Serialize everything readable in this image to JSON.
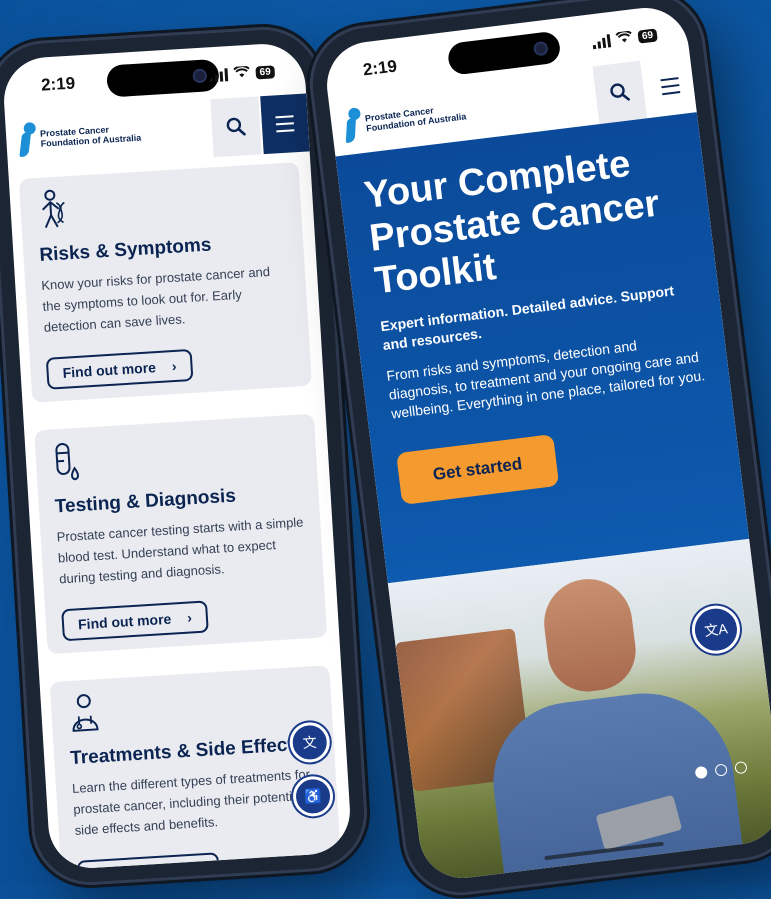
{
  "status": {
    "time": "2:19",
    "battery": "69"
  },
  "brand": {
    "name_line1": "Prostate Cancer",
    "name_line2": "Foundation of Australia"
  },
  "left_phone": {
    "cards": [
      {
        "icon": "person-dna-icon",
        "title": "Risks & Symptoms",
        "text": "Know your risks for prostate cancer and the symptoms to look out for. Early detection can save lives.",
        "button": "Find out more"
      },
      {
        "icon": "test-tube-icon",
        "title": "Testing & Diagnosis",
        "text": "Prostate cancer testing starts with a simple blood test. Understand what to expect during testing and diagnosis.",
        "button": "Find out more"
      },
      {
        "icon": "doctor-icon",
        "title": "Treatments & Side Effects",
        "text": "Learn the different types of treatments for prostate cancer, including their potential side effects and benefits.",
        "button": ""
      }
    ]
  },
  "right_phone": {
    "hero": {
      "title": "Your Complete Prostate Cancer Toolkit",
      "lead": "Expert information. Detailed advice. Support and resources.",
      "description": "From risks and symptoms, detection and diagnosis, to treatment and your ongoing care and wellbeing. Everything in one place, tailored for you.",
      "cta": "Get started"
    }
  },
  "colors": {
    "background": "#0d5ba8",
    "navy": "#0e2f63",
    "accent_orange": "#f49a2f",
    "card_bg": "#e9ebf0"
  }
}
